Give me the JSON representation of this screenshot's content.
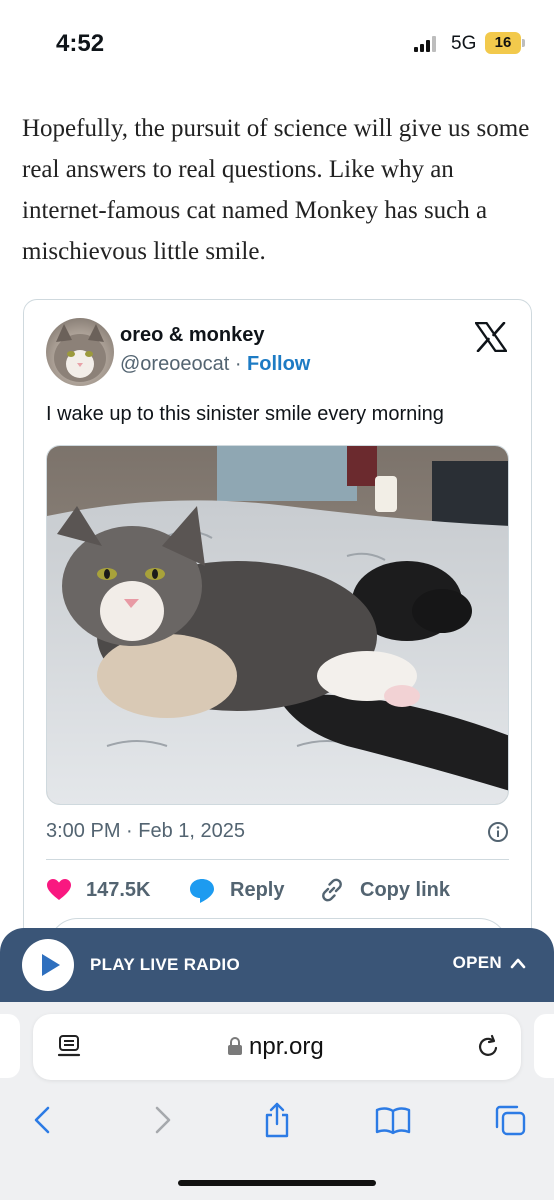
{
  "status_bar": {
    "time": "4:52",
    "network": "5G",
    "battery": "16"
  },
  "article": {
    "paragraph": "Hopefully, the pursuit of science will give us some real answers to real questions. Like why an internet-famous cat named Monkey has such a mischievous little smile."
  },
  "tweet": {
    "author_name": "oreo & monkey",
    "handle": "@oreoeocat",
    "separator": " · ",
    "follow_label": "Follow",
    "text": "I wake up to this sinister smile every morning",
    "timestamp": "3:00 PM · Feb 1, 2025",
    "likes": "147.5K",
    "reply_label": "Reply",
    "copy_label": "Copy link"
  },
  "radio": {
    "label": "PLAY LIVE RADIO",
    "open_label": "OPEN"
  },
  "browser": {
    "url": "npr.org"
  },
  "colors": {
    "accent": "#1d7bc4",
    "like": "#f91880",
    "radio_bar": "#3a5577",
    "ios_blue": "#2c7be5"
  }
}
